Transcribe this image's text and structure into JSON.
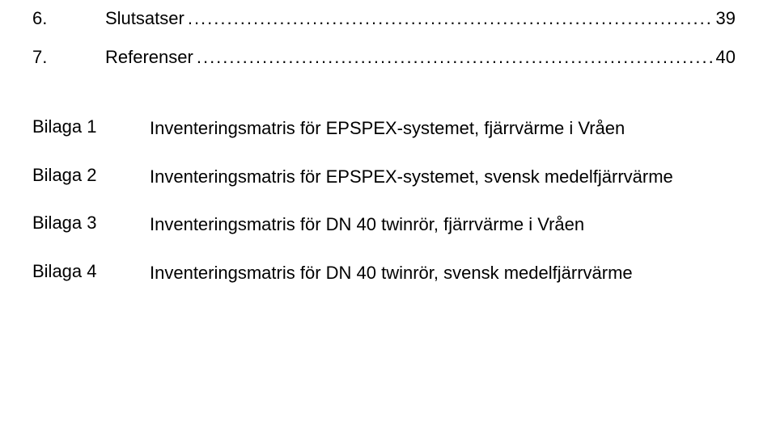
{
  "toc": [
    {
      "num": "6.",
      "title": "Slutsatser",
      "page": "39"
    },
    {
      "num": "7.",
      "title": "Referenser",
      "page": "40"
    }
  ],
  "appendices": [
    {
      "label": "Bilaga 1",
      "desc": "Inventeringsmatris för EPSPEX-systemet, fjärrvärme i Vråen"
    },
    {
      "label": "Bilaga 2",
      "desc": "Inventeringsmatris för EPSPEX-systemet, svensk medelfjärrvärme"
    },
    {
      "label": "Bilaga 3",
      "desc": "Inventeringsmatris för DN 40 twinrör, fjärrvärme i Vråen"
    },
    {
      "label": "Bilaga 4",
      "desc": "Inventeringsmatris för DN 40 twinrör, svensk medelfjärrvärme"
    }
  ],
  "dots": "................................................................................................................................"
}
